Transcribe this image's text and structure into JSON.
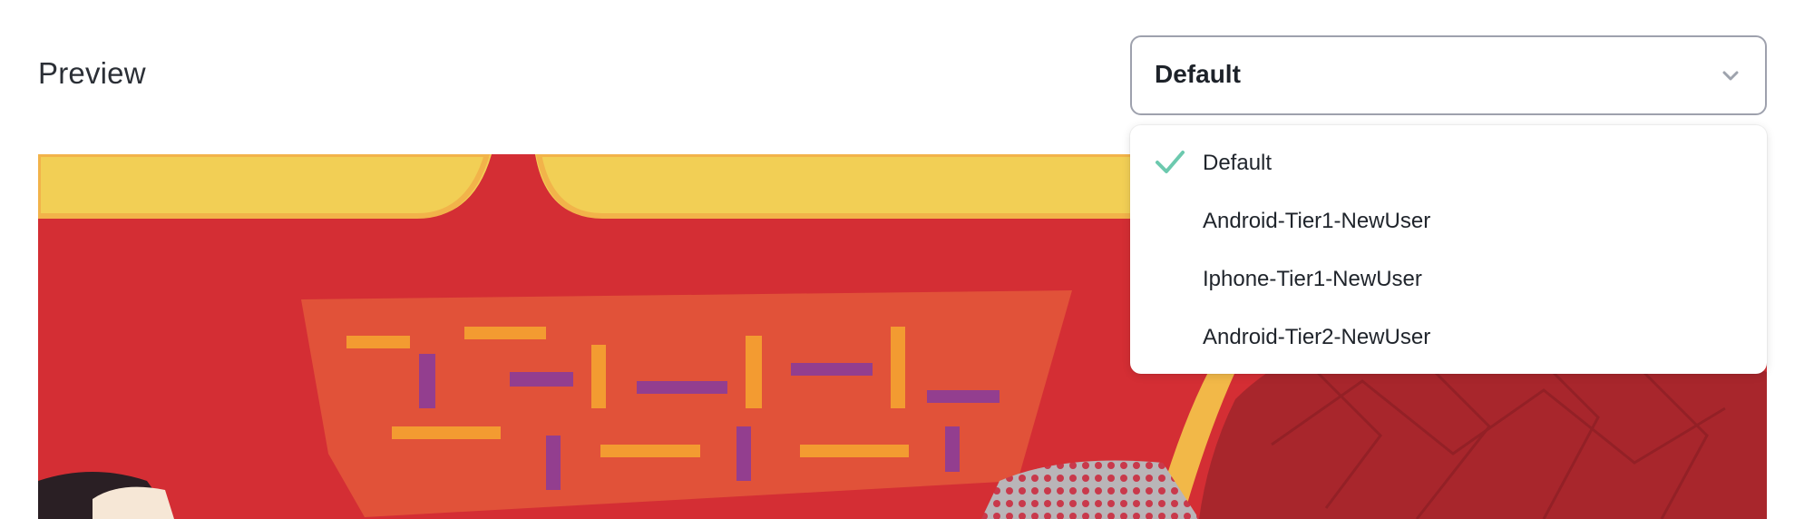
{
  "header": {
    "title": "Preview"
  },
  "select": {
    "value": "Default",
    "chevron_icon": "chevron-down-icon"
  },
  "dropdown": {
    "options": [
      {
        "label": "Default",
        "selected": true
      },
      {
        "label": "Android-Tier1-NewUser",
        "selected": false
      },
      {
        "label": "Iphone-Tier1-NewUser",
        "selected": false
      },
      {
        "label": "Android-Tier2-NewUser",
        "selected": false
      }
    ],
    "check_icon": "check-icon",
    "check_color": "#6cc9ae"
  },
  "preview": {
    "image": "promotional-banner-image",
    "colors": {
      "background": "#d42e34",
      "yellow": "#f2cf55"
    }
  }
}
